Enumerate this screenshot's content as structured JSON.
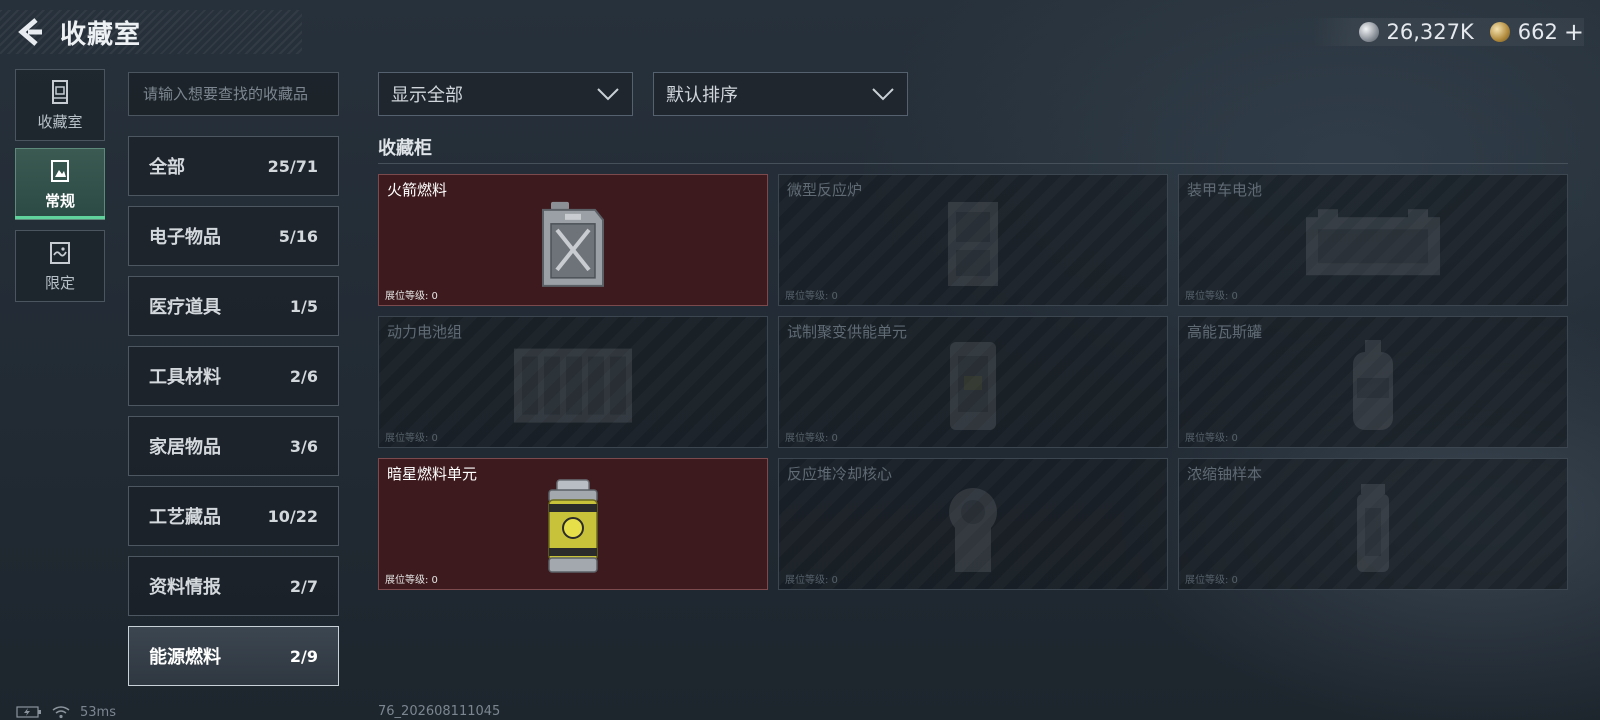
{
  "header": {
    "title": "收藏室"
  },
  "currency": {
    "silver": {
      "icon": "silver-coin-icon",
      "amount": "26,327K"
    },
    "gold": {
      "icon": "gold-coin-icon",
      "amount": "662",
      "add": "+"
    }
  },
  "sidebar": {
    "tabs": [
      {
        "label": "收藏室",
        "icon": "display-case-icon"
      },
      {
        "label": "常规",
        "icon": "image-frame-icon",
        "active": true
      },
      {
        "label": "限定",
        "icon": "scroll-icon"
      }
    ]
  },
  "search": {
    "placeholder": "请输入想要查找的收藏品"
  },
  "categories": [
    {
      "name": "全部",
      "count": "25/71"
    },
    {
      "name": "电子物品",
      "count": "5/16"
    },
    {
      "name": "医疗道具",
      "count": "1/5"
    },
    {
      "name": "工具材料",
      "count": "2/6"
    },
    {
      "name": "家居物品",
      "count": "3/6"
    },
    {
      "name": "工艺藏品",
      "count": "10/22"
    },
    {
      "name": "资料情报",
      "count": "2/7"
    },
    {
      "name": "能源燃料",
      "count": "2/9",
      "selected": true
    }
  ],
  "filters": {
    "display": {
      "value": "显示全部",
      "icon": "chevron-down-icon"
    },
    "sort": {
      "value": "默认排序",
      "icon": "chevron-down-icon"
    }
  },
  "cabinet": {
    "title": "收藏柜",
    "items": [
      {
        "name": "火箭燃料",
        "level_label": "展位等级: 0",
        "owned": true,
        "icon": "fuel-canister-icon"
      },
      {
        "name": "微型反应炉",
        "level_label": "展位等级: 0",
        "owned": false,
        "icon": "reactor-icon"
      },
      {
        "name": "装甲车电池",
        "level_label": "展位等级: 0",
        "owned": false,
        "icon": "battery-icon"
      },
      {
        "name": "动力电池组",
        "level_label": "展位等级: 0",
        "owned": false,
        "icon": "battery-pack-icon"
      },
      {
        "name": "试制聚变供能单元",
        "level_label": "展位等级: 0",
        "owned": false,
        "icon": "fusion-unit-icon"
      },
      {
        "name": "高能瓦斯罐",
        "level_label": "展位等级: 0",
        "owned": false,
        "icon": "gas-tank-icon"
      },
      {
        "name": "暗星燃料单元",
        "level_label": "展位等级: 0",
        "owned": true,
        "icon": "fuel-cell-icon"
      },
      {
        "name": "反应堆冷却核心",
        "level_label": "展位等级: 0",
        "owned": false,
        "icon": "cooling-core-icon"
      },
      {
        "name": "浓缩铀样本",
        "level_label": "展位等级: 0",
        "owned": false,
        "icon": "uranium-sample-icon"
      }
    ]
  },
  "status": {
    "ping": "53ms",
    "build": "76_202608111045"
  },
  "colors": {
    "owned_card": "#3d1a1d",
    "accent_green": "#5fd39b",
    "selected_tab": "#2b4a44"
  }
}
